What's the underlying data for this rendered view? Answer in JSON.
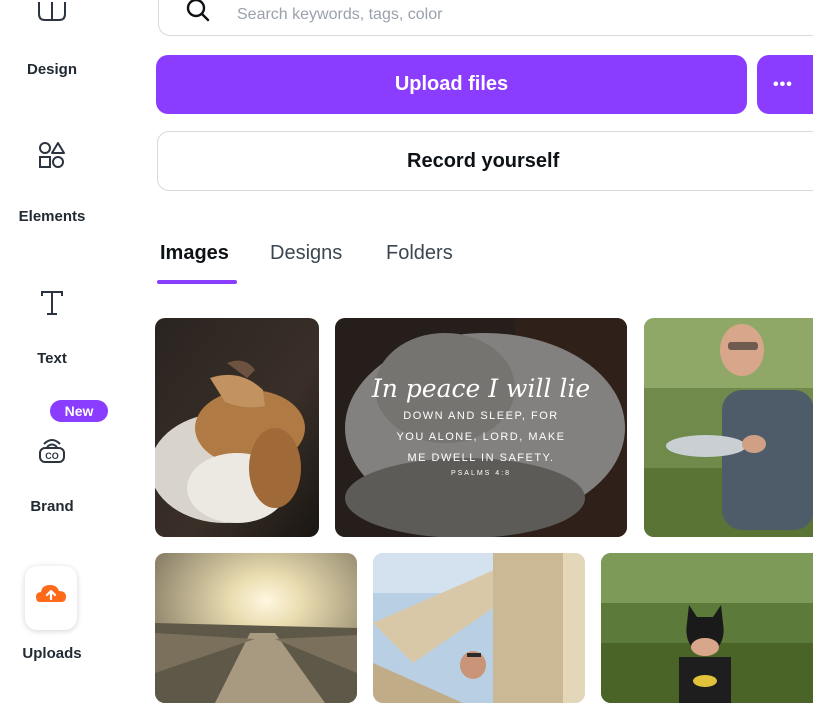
{
  "sidebar": {
    "items": [
      {
        "label": "Design",
        "icon": "design-icon"
      },
      {
        "label": "Elements",
        "icon": "elements-icon"
      },
      {
        "label": "Text",
        "icon": "text-icon"
      },
      {
        "label": "Brand",
        "icon": "brand-icon",
        "badge": "New"
      },
      {
        "label": "Uploads",
        "icon": "upload-cloud-icon",
        "active": true
      }
    ]
  },
  "search": {
    "placeholder": "Search keywords, tags, color"
  },
  "actions": {
    "upload_label": "Upload files",
    "more_label": "•••",
    "record_label": "Record yourself"
  },
  "tabs": [
    {
      "label": "Images",
      "active": true
    },
    {
      "label": "Designs",
      "active": false
    },
    {
      "label": "Folders",
      "active": false
    }
  ],
  "images": [
    {
      "name": "dog-photo"
    },
    {
      "name": "verse-photo",
      "overlay": {
        "line1": "In peace I will lie",
        "line2": "DOWN AND SLEEP, FOR YOU ALONE, LORD, MAKE ME DWELL IN SAFETY.",
        "line3": "PSALMS 4:8"
      }
    },
    {
      "name": "man-fish-photo"
    },
    {
      "name": "sunset-boardwalk-photo"
    },
    {
      "name": "wood-structure-photo"
    },
    {
      "name": "batman-kid-photo"
    }
  ],
  "colors": {
    "accent": "#8b3dff",
    "upload_icon": "#ff6a1a"
  }
}
